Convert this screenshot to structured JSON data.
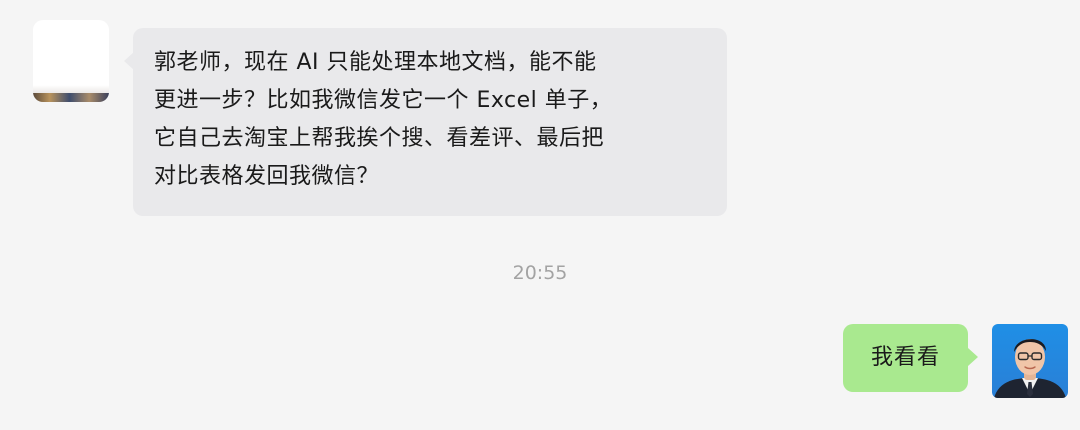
{
  "messages": [
    {
      "side": "left",
      "lines": [
        "郭老师，现在 AI 只能处理本地文档，能不能",
        "更进一步？比如我微信发它一个 Excel 单子，",
        "它自己去淘宝上帮我挨个搜、看差评、最后把",
        "对比表格发回我微信？"
      ]
    },
    {
      "side": "right",
      "text": "我看看"
    }
  ],
  "timestamp": "20:55",
  "colors": {
    "background": "#f5f5f5",
    "incoming_bubble": "#e9e9eb",
    "outgoing_bubble": "#a9e98f",
    "timestamp_text": "#a3a3a3"
  },
  "icons": {
    "left_avatar": "contact-avatar-icon",
    "right_avatar": "user-avatar-icon"
  }
}
